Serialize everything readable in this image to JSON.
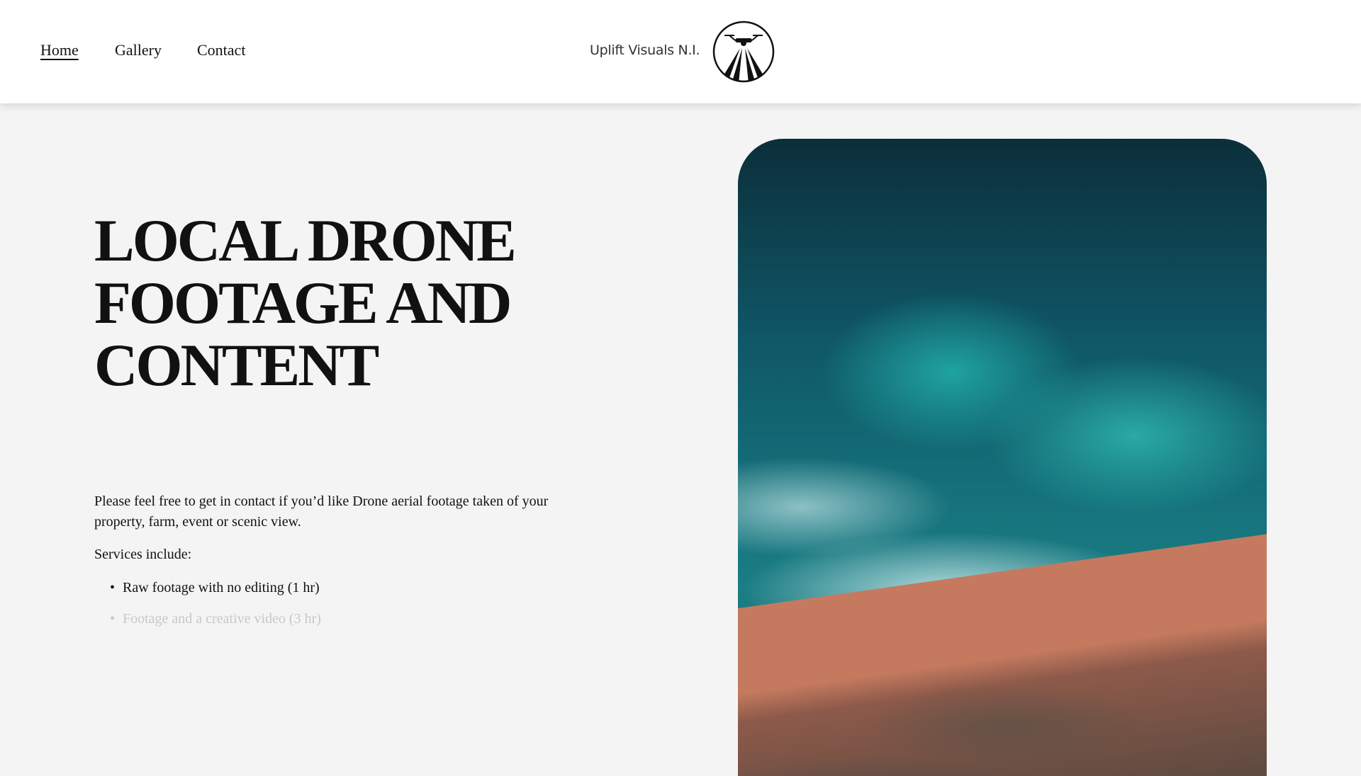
{
  "nav": {
    "items": [
      {
        "label": "Home",
        "active": true
      },
      {
        "label": "Gallery"
      },
      {
        "label": "Contact"
      }
    ]
  },
  "logo": {
    "text": "Uplift Visuals N.I.",
    "icon": "drone-circle-logo"
  },
  "hero": {
    "title": "LOCAL DRONE FOOTAGE AND CONTENT",
    "intro": "Please feel free to get in contact if you’d like Drone aerial footage taken of your property, farm, event or scenic view.",
    "services_label": "Services include:",
    "services": [
      "Raw footage with no editing (1 hr)",
      "Footage and a creative video (3 hr)"
    ]
  },
  "image": {
    "subject": "aerial-coastline-photo"
  }
}
